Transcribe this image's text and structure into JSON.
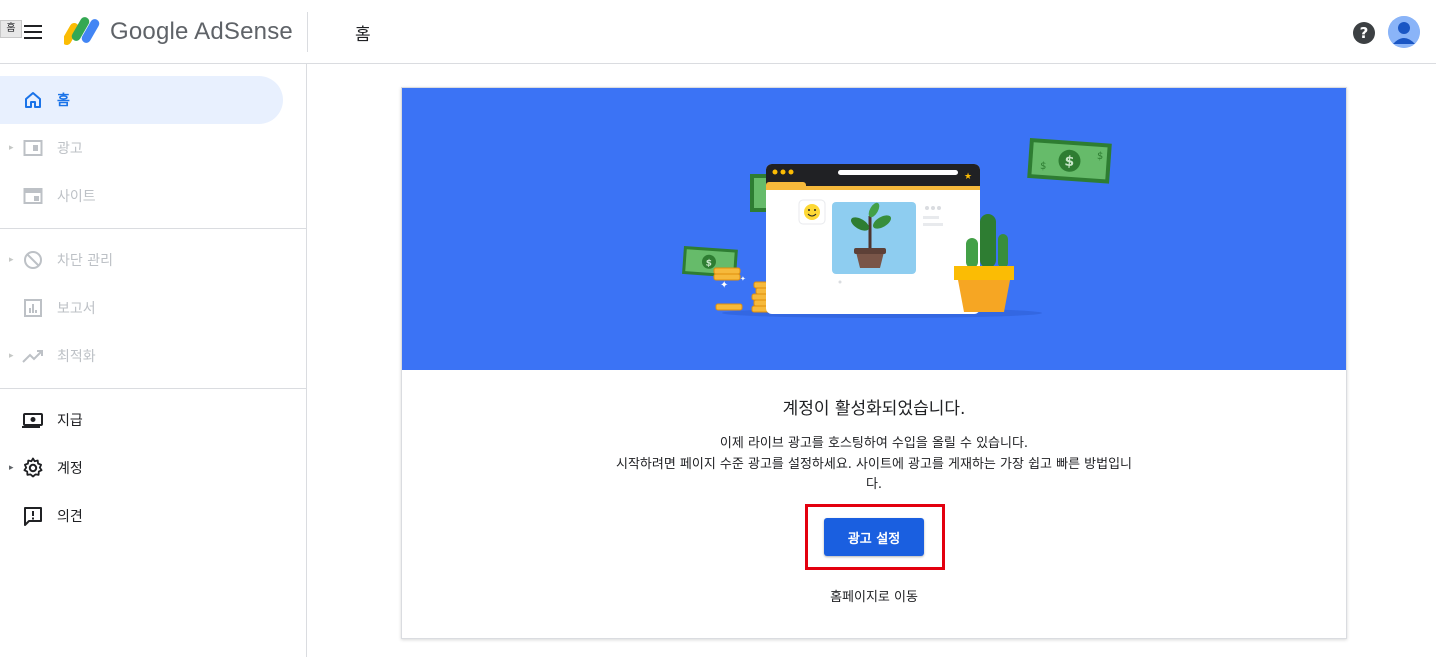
{
  "header": {
    "tooltip": "홈",
    "app_name": "Google AdSense",
    "page_title": "홈"
  },
  "sidebar": {
    "items": [
      {
        "label": "홈",
        "icon": "home-icon",
        "state": "active"
      },
      {
        "label": "광고",
        "icon": "ads-icon",
        "state": "disabled"
      },
      {
        "label": "사이트",
        "icon": "sites-icon",
        "state": "disabled"
      },
      {
        "label": "차단 관리",
        "icon": "block-icon",
        "state": "disabled"
      },
      {
        "label": "보고서",
        "icon": "reports-icon",
        "state": "disabled"
      },
      {
        "label": "최적화",
        "icon": "optimization-icon",
        "state": "disabled"
      },
      {
        "label": "지급",
        "icon": "payments-icon",
        "state": "enabled"
      },
      {
        "label": "계정",
        "icon": "gear-icon",
        "state": "enabled"
      },
      {
        "label": "의견",
        "icon": "feedback-icon",
        "state": "enabled"
      }
    ]
  },
  "card": {
    "title": "계정이 활성화되었습니다.",
    "desc_line1": "이제 라이브 광고를 호스팅하여 수입을 올릴 수 있습니다.",
    "desc_line2": "시작하려면 페이지 수준 광고를 설정하세요. 사이트에 광고를 게재하는 가장 쉽고 빠른 방법입니다.",
    "primary_button": "광고 설정",
    "secondary_link": "홈페이지로 이동"
  },
  "colors": {
    "accent": "#1a73e8",
    "hero_background": "#3b73f5",
    "button": "#1a5fe0",
    "highlight": "#e3000f"
  }
}
